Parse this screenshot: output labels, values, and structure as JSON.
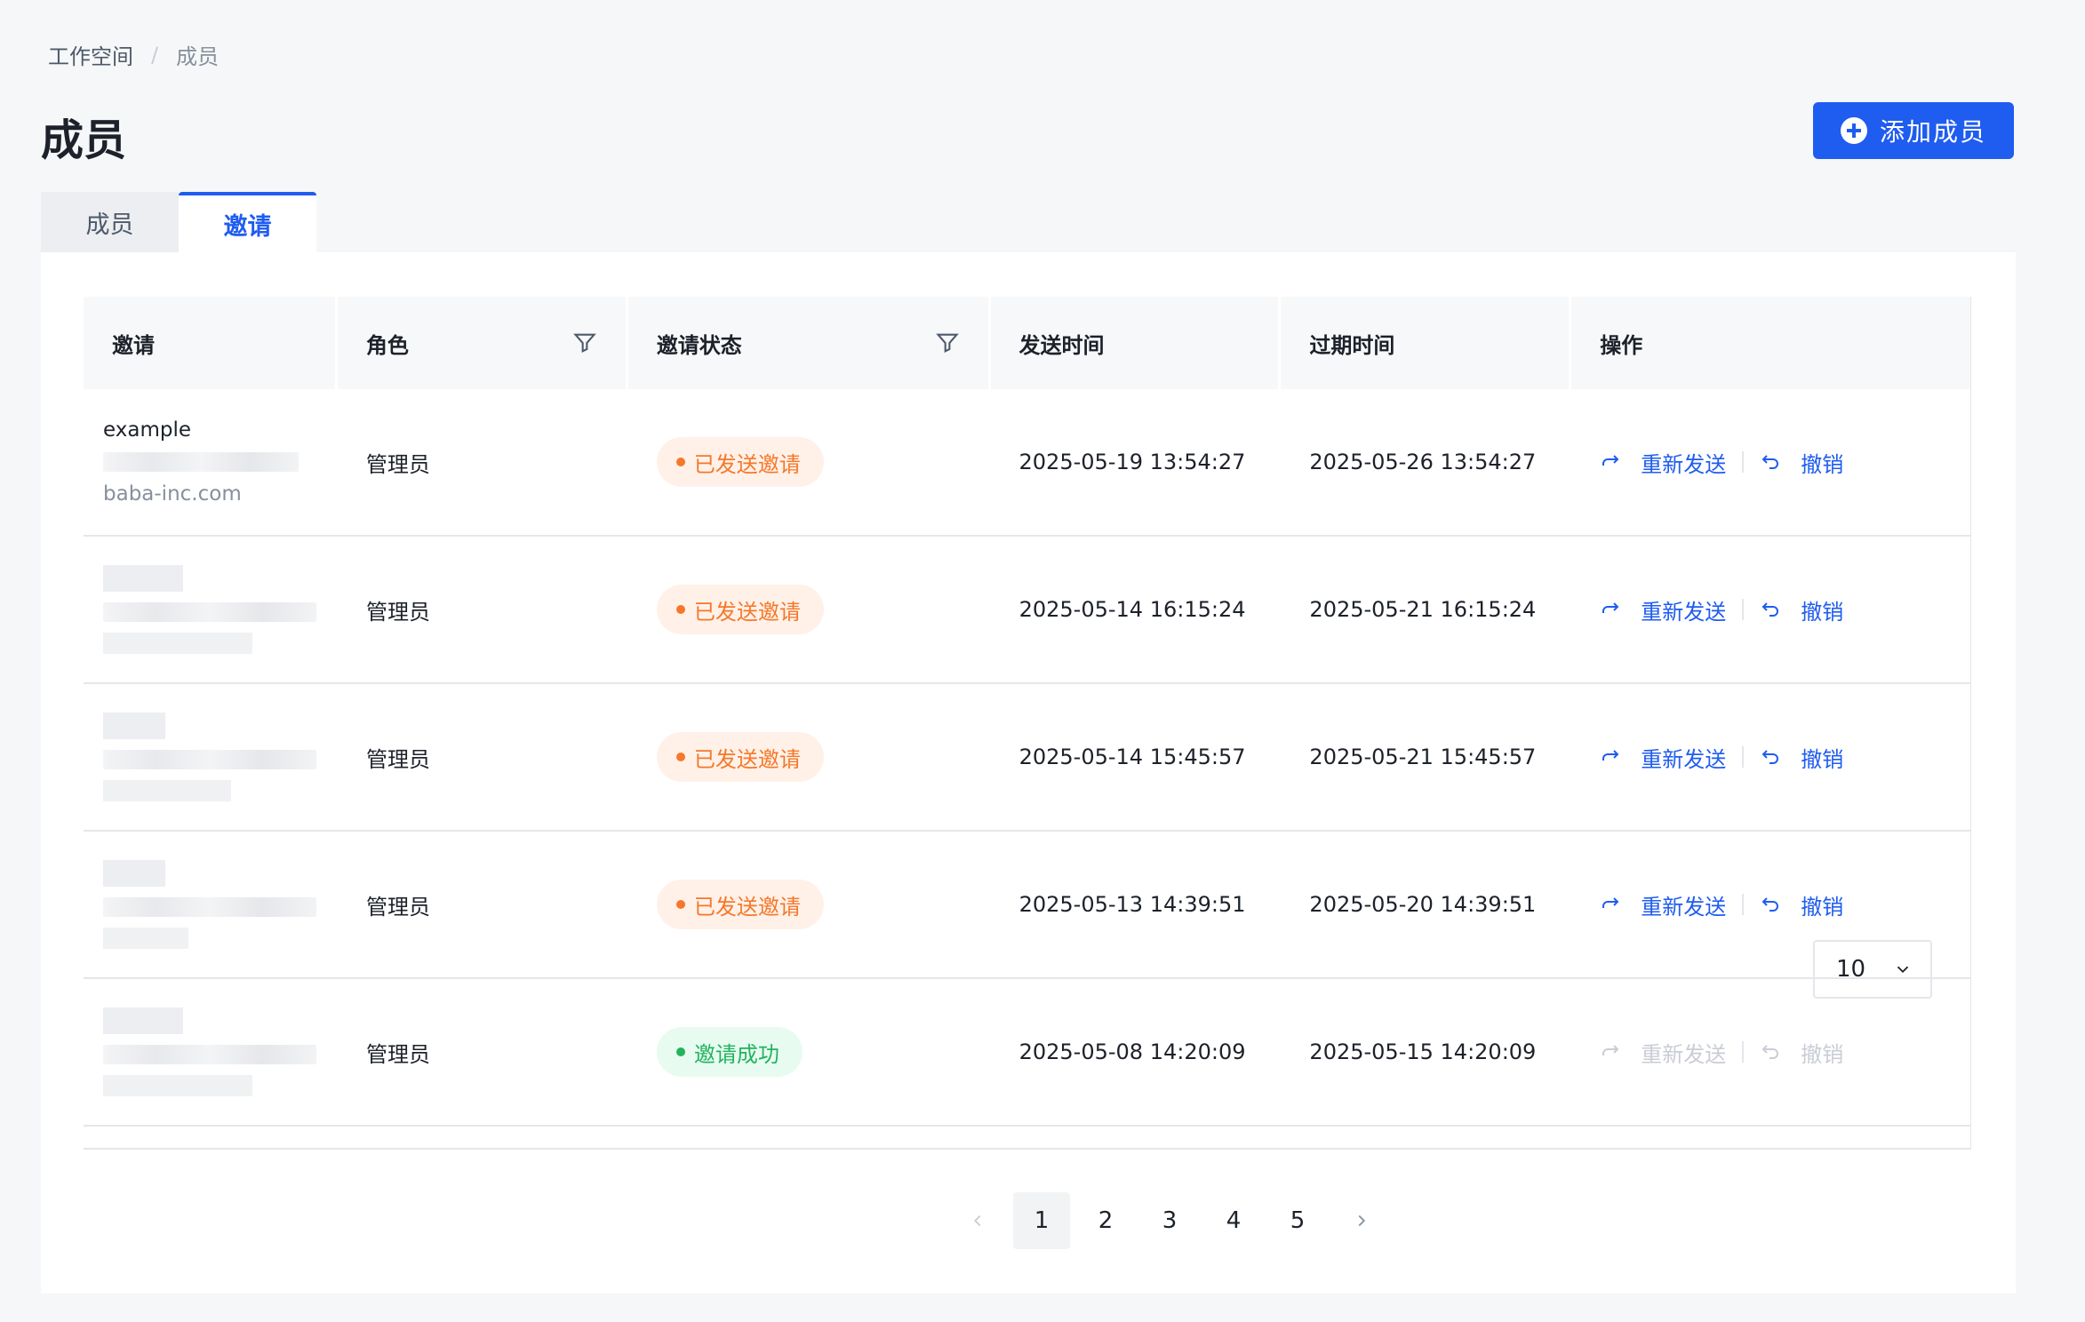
{
  "breadcrumb": {
    "parent": "工作空间",
    "separator": "/",
    "current": "成员"
  },
  "page_title": "成员",
  "add_button": "添加成员",
  "tabs": [
    {
      "label": "成员",
      "active": false
    },
    {
      "label": "邀请",
      "active": true
    }
  ],
  "table": {
    "headers": [
      "邀请",
      "角色",
      "邀请状态",
      "发送时间",
      "过期时间",
      "操作"
    ],
    "rows": [
      {
        "name": "example",
        "domain": "baba-inc.com",
        "role": "管理员",
        "status": "已发送邀请",
        "status_type": "pending",
        "sent": "2025-05-19 13:54:27",
        "expires": "2025-05-26 13:54:27",
        "enabled": true
      },
      {
        "name": "",
        "domain": "",
        "role": "管理员",
        "status": "已发送邀请",
        "status_type": "pending",
        "sent": "2025-05-14 16:15:24",
        "expires": "2025-05-21 16:15:24",
        "enabled": true
      },
      {
        "name": "",
        "domain": "",
        "role": "管理员",
        "status": "已发送邀请",
        "status_type": "pending",
        "sent": "2025-05-14 15:45:57",
        "expires": "2025-05-21 15:45:57",
        "enabled": true
      },
      {
        "name": "",
        "domain": "",
        "role": "管理员",
        "status": "已发送邀请",
        "status_type": "pending",
        "sent": "2025-05-13 14:39:51",
        "expires": "2025-05-20 14:39:51",
        "enabled": true
      },
      {
        "name": "",
        "domain": "",
        "role": "管理员",
        "status": "邀请成功",
        "status_type": "success",
        "sent": "2025-05-08 14:20:09",
        "expires": "2025-05-15 14:20:09",
        "enabled": false
      }
    ],
    "actions": {
      "resend": "重新发送",
      "revoke": "撤销"
    }
  },
  "pagination": {
    "pages": [
      "1",
      "2",
      "3",
      "4",
      "5"
    ],
    "current": "1",
    "page_size": "10"
  },
  "colors": {
    "primary": "#1f5cf0",
    "pending": "#f5782a",
    "success": "#22b35e"
  }
}
